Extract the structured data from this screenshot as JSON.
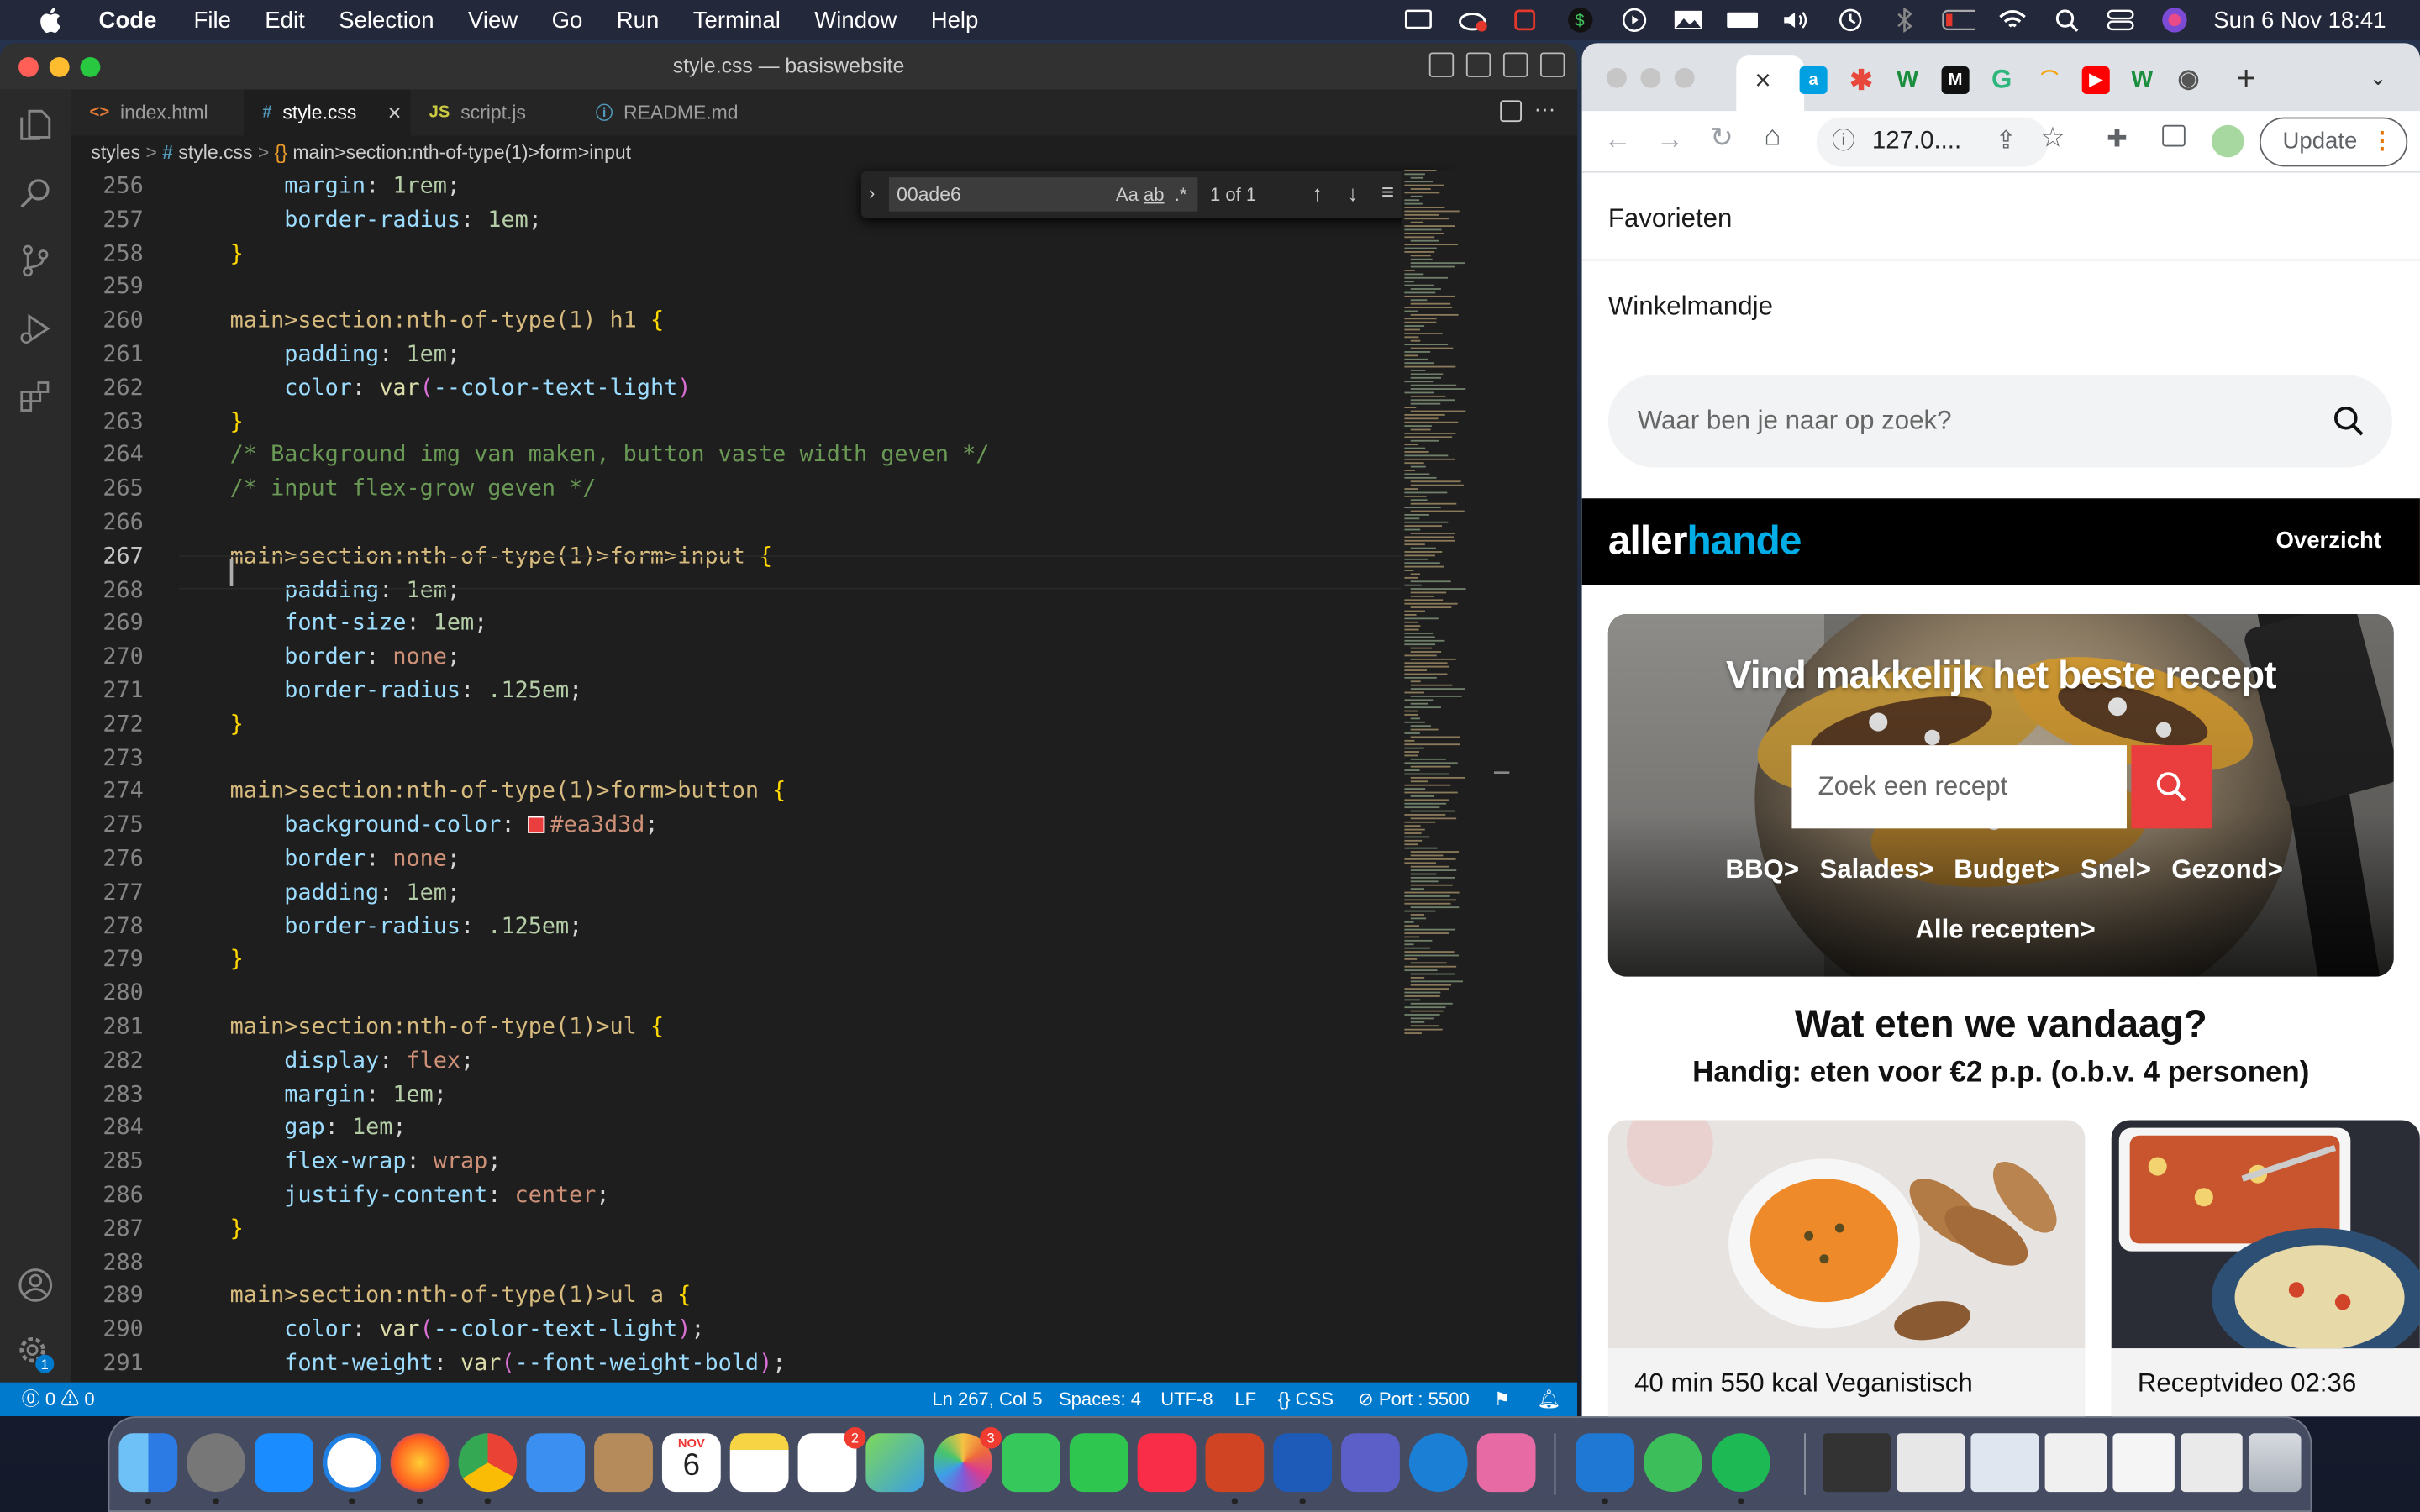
{
  "menubar": {
    "app": "Code",
    "items": [
      "File",
      "Edit",
      "Selection",
      "View",
      "Go",
      "Run",
      "Terminal",
      "Window",
      "Help"
    ],
    "clock": "Sun 6 Nov  18:41"
  },
  "vscode": {
    "window_title": "style.css — basiswebsite",
    "tabs": [
      {
        "icon": "<>",
        "label": "index.html",
        "icon_color": "#e37933"
      },
      {
        "icon": "#",
        "label": "style.css",
        "icon_color": "#519aba"
      },
      {
        "icon": "JS",
        "label": "script.js",
        "icon_color": "#cbcb41"
      },
      {
        "icon": "ⓘ",
        "label": "README.md",
        "icon_color": "#519aba"
      }
    ],
    "close_glyph": "×",
    "breadcrumb": {
      "folder": "styles",
      "file": "style.css",
      "symbol": "main>section:nth-of-type(1)>form>input"
    },
    "find": {
      "query": "00ade6",
      "opt_case": "Aa",
      "opt_word": "ab",
      "opt_regex": ".*",
      "result": "1 of 1"
    },
    "status": {
      "problems": "⓪ 0 ⚠ 0",
      "position": "Ln 267, Col 5",
      "spaces": "Spaces: 4",
      "encoding": "UTF-8",
      "eol": "LF",
      "language": "{} CSS",
      "port": "⊘ Port : 5500"
    },
    "settings_badge": "1",
    "code_lines": [
      {
        "n": "256",
        "t": [
          [
            "prop",
            "    margin"
          ],
          [
            "pun",
            ": "
          ],
          [
            "num",
            "1rem"
          ],
          [
            "pun",
            ";"
          ]
        ]
      },
      {
        "n": "257",
        "t": [
          [
            "prop",
            "    border-radius"
          ],
          [
            "pun",
            ": "
          ],
          [
            "num",
            "1em"
          ],
          [
            "pun",
            ";"
          ]
        ]
      },
      {
        "n": "258",
        "t": [
          [
            "br1",
            "}"
          ]
        ]
      },
      {
        "n": "259",
        "t": []
      },
      {
        "n": "260",
        "t": [
          [
            "sel",
            "main>section:nth-of-type(1) h1 "
          ],
          [
            "br1",
            "{"
          ]
        ]
      },
      {
        "n": "261",
        "t": [
          [
            "prop",
            "    padding"
          ],
          [
            "pun",
            ": "
          ],
          [
            "num",
            "1em"
          ],
          [
            "pun",
            ";"
          ]
        ]
      },
      {
        "n": "262",
        "t": [
          [
            "prop",
            "    color"
          ],
          [
            "pun",
            ": "
          ],
          [
            "fn",
            "var"
          ],
          [
            "br2",
            "("
          ],
          [
            "var",
            "--color-text-light"
          ],
          [
            "br2",
            ")"
          ]
        ]
      },
      {
        "n": "263",
        "t": [
          [
            "br1",
            "}"
          ]
        ]
      },
      {
        "n": "264",
        "t": [
          [
            "cm",
            "/* Background img van maken, button vaste width geven */"
          ]
        ]
      },
      {
        "n": "265",
        "t": [
          [
            "cm",
            "/* input flex-grow geven */"
          ]
        ]
      },
      {
        "n": "266",
        "t": []
      },
      {
        "n": "267",
        "t": [
          [
            "sel",
            "main>section:nth-of-type(1)>form>input "
          ],
          [
            "br1",
            "{"
          ]
        ],
        "cur": true
      },
      {
        "n": "268",
        "t": [
          [
            "prop",
            "    padding"
          ],
          [
            "pun",
            ": "
          ],
          [
            "num",
            "1em"
          ],
          [
            "pun",
            ";"
          ]
        ]
      },
      {
        "n": "269",
        "t": [
          [
            "prop",
            "    font-size"
          ],
          [
            "pun",
            ": "
          ],
          [
            "num",
            "1em"
          ],
          [
            "pun",
            ";"
          ]
        ]
      },
      {
        "n": "270",
        "t": [
          [
            "prop",
            "    border"
          ],
          [
            "pun",
            ": "
          ],
          [
            "val",
            "none"
          ],
          [
            "pun",
            ";"
          ]
        ]
      },
      {
        "n": "271",
        "t": [
          [
            "prop",
            "    border-radius"
          ],
          [
            "pun",
            ": "
          ],
          [
            "num",
            ".125em"
          ],
          [
            "pun",
            ";"
          ]
        ]
      },
      {
        "n": "272",
        "t": [
          [
            "br1",
            "}"
          ]
        ]
      },
      {
        "n": "273",
        "t": []
      },
      {
        "n": "274",
        "t": [
          [
            "sel",
            "main>section:nth-of-type(1)>form>button "
          ],
          [
            "br1",
            "{"
          ]
        ]
      },
      {
        "n": "275",
        "t": [
          [
            "prop",
            "    background-color"
          ],
          [
            "pun",
            ": "
          ],
          [
            "swatch",
            "#ea3d3d"
          ],
          [
            "val",
            "#ea3d3d"
          ],
          [
            "pun",
            ";"
          ]
        ]
      },
      {
        "n": "276",
        "t": [
          [
            "prop",
            "    border"
          ],
          [
            "pun",
            ": "
          ],
          [
            "val",
            "none"
          ],
          [
            "pun",
            ";"
          ]
        ]
      },
      {
        "n": "277",
        "t": [
          [
            "prop",
            "    padding"
          ],
          [
            "pun",
            ": "
          ],
          [
            "num",
            "1em"
          ],
          [
            "pun",
            ";"
          ]
        ]
      },
      {
        "n": "278",
        "t": [
          [
            "prop",
            "    border-radius"
          ],
          [
            "pun",
            ": "
          ],
          [
            "num",
            ".125em"
          ],
          [
            "pun",
            ";"
          ]
        ]
      },
      {
        "n": "279",
        "t": [
          [
            "br1",
            "}"
          ]
        ]
      },
      {
        "n": "280",
        "t": []
      },
      {
        "n": "281",
        "t": [
          [
            "sel",
            "main>section:nth-of-type(1)>ul "
          ],
          [
            "br1",
            "{"
          ]
        ]
      },
      {
        "n": "282",
        "t": [
          [
            "prop",
            "    display"
          ],
          [
            "pun",
            ": "
          ],
          [
            "val",
            "flex"
          ],
          [
            "pun",
            ";"
          ]
        ]
      },
      {
        "n": "283",
        "t": [
          [
            "prop",
            "    margin"
          ],
          [
            "pun",
            ": "
          ],
          [
            "num",
            "1em"
          ],
          [
            "pun",
            ";"
          ]
        ]
      },
      {
        "n": "284",
        "t": [
          [
            "prop",
            "    gap"
          ],
          [
            "pun",
            ": "
          ],
          [
            "num",
            "1em"
          ],
          [
            "pun",
            ";"
          ]
        ]
      },
      {
        "n": "285",
        "t": [
          [
            "prop",
            "    flex-wrap"
          ],
          [
            "pun",
            ": "
          ],
          [
            "val",
            "wrap"
          ],
          [
            "pun",
            ";"
          ]
        ]
      },
      {
        "n": "286",
        "t": [
          [
            "prop",
            "    justify-content"
          ],
          [
            "pun",
            ": "
          ],
          [
            "val",
            "center"
          ],
          [
            "pun",
            ";"
          ]
        ]
      },
      {
        "n": "287",
        "t": [
          [
            "br1",
            "}"
          ]
        ]
      },
      {
        "n": "288",
        "t": []
      },
      {
        "n": "289",
        "t": [
          [
            "sel",
            "main>section:nth-of-type(1)>ul a "
          ],
          [
            "br1",
            "{"
          ]
        ]
      },
      {
        "n": "290",
        "t": [
          [
            "prop",
            "    color"
          ],
          [
            "pun",
            ": "
          ],
          [
            "fn",
            "var"
          ],
          [
            "br2",
            "("
          ],
          [
            "var",
            "--color-text-light"
          ],
          [
            "br2",
            ")"
          ],
          [
            "pun",
            ";"
          ]
        ]
      },
      {
        "n": "291",
        "t": [
          [
            "prop",
            "    font-weight"
          ],
          [
            "pun",
            ": "
          ],
          [
            "fn",
            "var"
          ],
          [
            "br2",
            "("
          ],
          [
            "var",
            "--font-weight-bold"
          ],
          [
            "br2",
            ")"
          ],
          [
            "pun",
            ";"
          ]
        ]
      }
    ]
  },
  "chrome": {
    "omnibox": "127.0....",
    "update": "Update",
    "links": [
      "Favorieten",
      "Winkelmandje"
    ],
    "search_placeholder": "Waar ben je naar op zoek?",
    "brand_a": "aller",
    "brand_b": "hande",
    "overzicht": "Overzicht",
    "hero_title": "Vind makkelijk het beste recept",
    "hero_search_placeholder": "Zoek een recept",
    "chips": [
      "BBQ>",
      "Salades>",
      "Budget>",
      "Snel>",
      "Gezond>"
    ],
    "all_recipes": "Alle recepten>",
    "heading": "Wat eten we vandaag?",
    "subheading": "Handig: eten voor €2 p.p. (o.b.v. 4 personen)",
    "card1": "40 min  550 kcal  Veganistisch",
    "card2": "Receptvideo  02:36"
  },
  "dock": {
    "calendar_month": "NOV",
    "calendar_day": "6",
    "reminders_badge": "2",
    "photos_badge": "3"
  },
  "colors": {
    "accent": "#007acc",
    "brand_blue": "#00ade6",
    "search_red": "#ea3d3d"
  }
}
